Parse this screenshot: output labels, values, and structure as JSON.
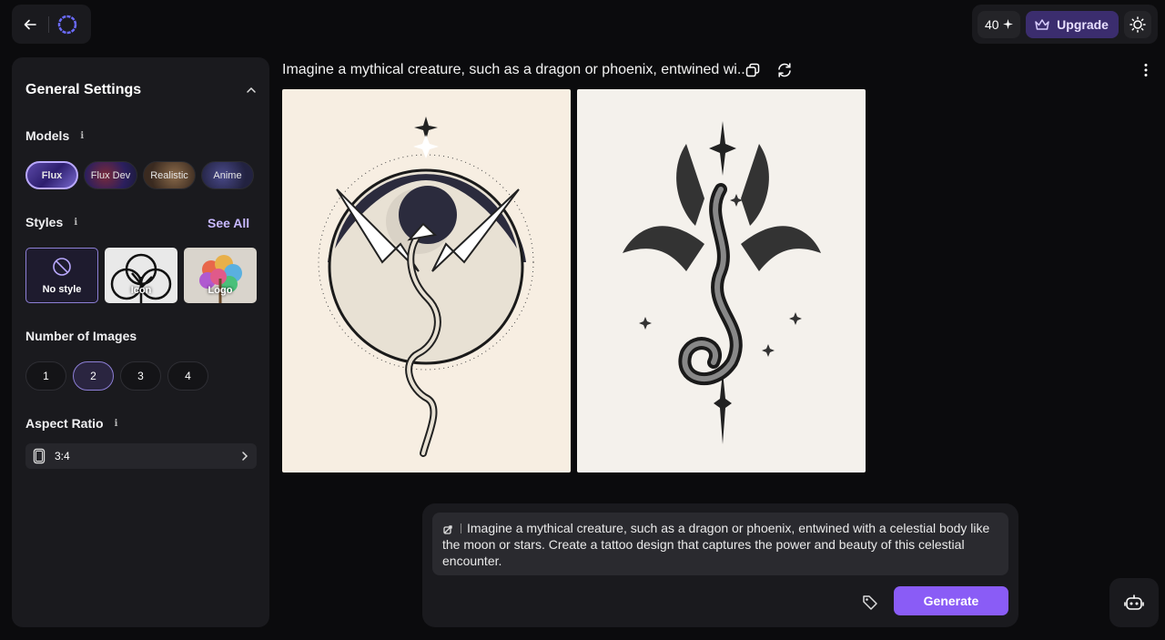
{
  "header": {
    "credits": "40",
    "upgrade_label": "Upgrade"
  },
  "sidebar": {
    "title": "General Settings",
    "models": {
      "label": "Models",
      "items": [
        "Flux",
        "Flux Dev",
        "Realistic",
        "Anime"
      ],
      "selected": "Flux"
    },
    "styles": {
      "label": "Styles",
      "see_all": "See All",
      "items": [
        "No style",
        "Icon",
        "Logo"
      ],
      "selected": "No style"
    },
    "num_images": {
      "label": "Number of Images",
      "options": [
        "1",
        "2",
        "3",
        "4"
      ],
      "selected": "2"
    },
    "aspect": {
      "label": "Aspect Ratio",
      "value": "3:4"
    }
  },
  "main": {
    "prompt_title": "Imagine a mythical creature, such as a dragon or phoenix, entwined wi...",
    "prompt_text": "Imagine a mythical creature, such as a dragon or phoenix, entwined with a celestial body like the moon or stars. Create a tattoo design that captures the power and beauty of this celestial encounter.",
    "generate_label": "Generate"
  },
  "colors": {
    "accent": "#8a5cf6",
    "upgrade_bg": "#3b2d6e",
    "panel": "#1a1a1e"
  }
}
